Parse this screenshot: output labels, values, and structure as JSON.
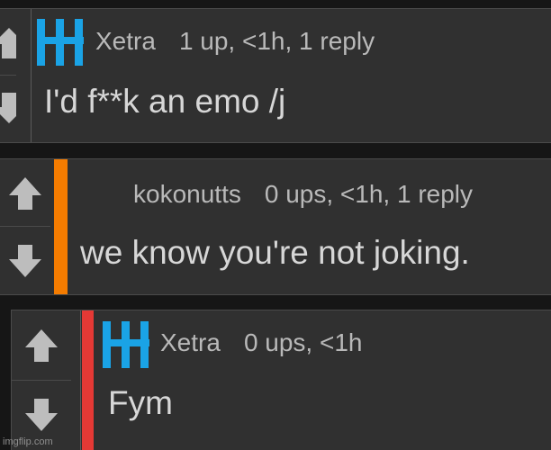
{
  "comments": [
    {
      "user": "Xetra",
      "meta": "1 up, <1h, 1 reply",
      "text": "I'd f**k an emo /j",
      "bar_color": "",
      "has_logo": true
    },
    {
      "user": "kokonutts",
      "meta": "0 ups, <1h, 1 reply",
      "text": "we know you're not joking.",
      "bar_color": "#f57c00",
      "has_logo": false
    },
    {
      "user": "Xetra",
      "meta": "0 ups, <1h",
      "text": "Fym",
      "bar_color": "#e53935",
      "has_logo": true
    }
  ],
  "icons": {
    "upvote": "arrow-up-icon",
    "downvote": "arrow-down-icon",
    "user_logo": "user-logo-icon"
  },
  "colors": {
    "background": "#161616",
    "panel": "#303030",
    "logo_blue": "#1aa3e6",
    "arrow": "#bdbdbd"
  },
  "watermark": "imgflip.com"
}
